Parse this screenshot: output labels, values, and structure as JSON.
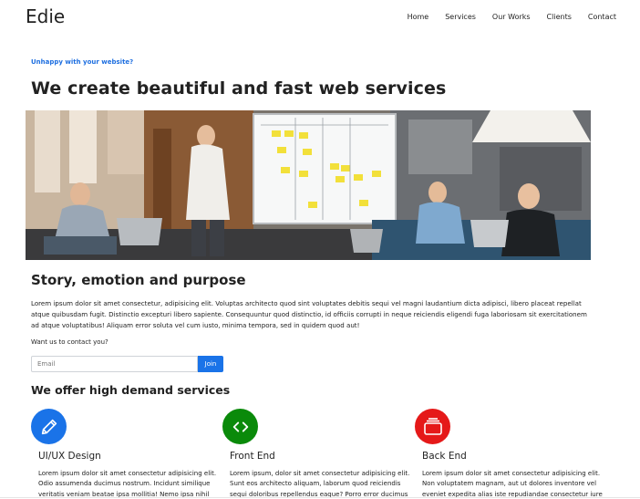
{
  "header": {
    "brand": "Edie",
    "nav": [
      "Home",
      "Services",
      "Our Works",
      "Clients",
      "Contact"
    ]
  },
  "hero": {
    "eyebrow": "Unhappy with your website?",
    "title": "We create beautiful and fast web services",
    "image_alt": "Team meeting in front of a whiteboard with sticky notes"
  },
  "story": {
    "title": "Story, emotion and purpose",
    "text": "Lorem ipsum dolor sit amet consectetur, adipisicing elit. Voluptas architecto quod sint voluptates debitis sequi vel magni laudantium dicta adipisci, libero placeat repellat atque quibusdam fugit. Distinctio excepturi libero sapiente. Consequuntur quod distinctio, id officiis corrupti in neque reiciendis eligendi fuga laboriosam sit exercitationem ad atque voluptatibus! Aliquam error soluta vel cum iusto, minima tempora, sed in quidem quod aut!",
    "contact_question": "Want us to contact you?",
    "email_placeholder": "Email",
    "join_label": "Join"
  },
  "services": {
    "title": "We offer high demand services",
    "items": [
      {
        "name": "UI/UX Design",
        "icon": "pencil-icon",
        "color": "#1a73e8",
        "desc": "Lorem ipsum dolor sit amet consectetur adipisicing elit. Odio assumenda ducimus nostrum. Incidunt similique veritatis veniam beatae ipsa mollitia! Nemo ipsa nihil"
      },
      {
        "name": "Front End",
        "icon": "code-icon",
        "color": "#0a8a0a",
        "desc": "Lorem ipsum, dolor sit amet consectetur adipisicing elit. Sunt eos architecto aliquam, laborum quod reiciendis sequi doloribus repellendus eaque? Porro error ducimus"
      },
      {
        "name": "Back End",
        "icon": "layers-icon",
        "color": "#e51919",
        "desc": "Lorem ipsum dolor sit amet consectetur adipisicing elit. Non voluptatem magnam, aut ut dolores inventore vel eveniet expedita alias iste repudiandae consectetur iure"
      }
    ]
  }
}
